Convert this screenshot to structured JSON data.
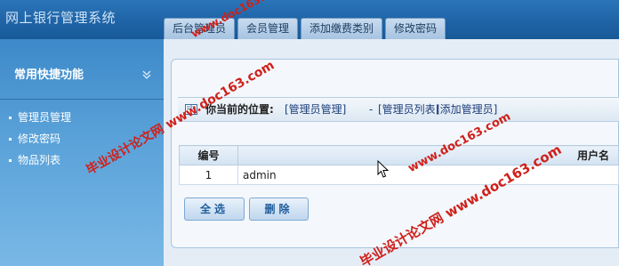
{
  "app": {
    "title": "网上银行管理系统"
  },
  "tabs": [
    {
      "label": "后台管理员"
    },
    {
      "label": "会员管理"
    },
    {
      "label": "添加缴费类别"
    },
    {
      "label": "修改密码"
    }
  ],
  "sidebar": {
    "heading": "常用快捷功能",
    "items": [
      {
        "label": "管理员管理"
      },
      {
        "label": "修改密码"
      },
      {
        "label": "物品列表"
      }
    ]
  },
  "location": {
    "label": "你当前的位置:",
    "crumb1": "[管理员管理]",
    "separator": "-",
    "crumb2": "[管理员列表]",
    "add_link": "[添加管理员]"
  },
  "table": {
    "headers": [
      "编号",
      "用户名"
    ],
    "rows": [
      {
        "id": "1",
        "username": "admin"
      }
    ]
  },
  "buttons": {
    "select_all": "全选",
    "delete": "删除"
  },
  "watermarks": {
    "url": "www.doc163.com",
    "slogan_url": "毕业设计论文网 www.doc163.com"
  },
  "colors": {
    "header_blue": "#1f64a6",
    "sidebar_blue": "#4f97d2",
    "watermark_red": "#d0201a",
    "link_blue": "#1d3e7a"
  }
}
